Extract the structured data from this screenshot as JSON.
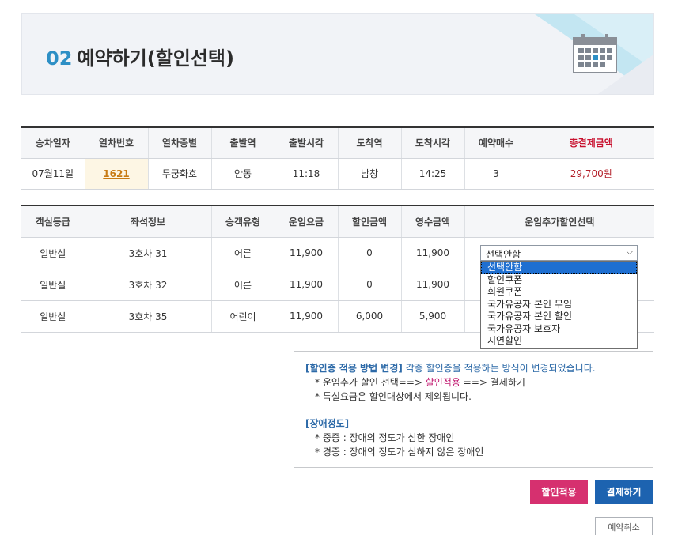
{
  "header": {
    "step_number": "02",
    "title": "예약하기(할인선택)",
    "icon": "calendar-icon"
  },
  "trip_table": {
    "headers": [
      "승차일자",
      "열차번호",
      "열차종별",
      "출발역",
      "출발시각",
      "도착역",
      "도착시각",
      "예약매수",
      "총결제금액"
    ],
    "row": {
      "date": "07월11일",
      "train_no": "1621",
      "train_type": "무궁화호",
      "dep_station": "안동",
      "dep_time": "11:18",
      "arr_station": "남창",
      "arr_time": "14:25",
      "count": "3",
      "total": "29,700원"
    }
  },
  "seat_table": {
    "headers": [
      "객실등급",
      "좌석정보",
      "승객유형",
      "운임요금",
      "할인금액",
      "영수금액",
      "운임추가할인선택"
    ],
    "rows": [
      {
        "grade": "일반실",
        "seat": "3호차 31",
        "type": "어른",
        "fare": "11,900",
        "discount": "0",
        "receipt": "11,900"
      },
      {
        "grade": "일반실",
        "seat": "3호차 32",
        "type": "어른",
        "fare": "11,900",
        "discount": "0",
        "receipt": "11,900"
      },
      {
        "grade": "일반실",
        "seat": "3호차 35",
        "type": "어린이",
        "fare": "11,900",
        "discount": "6,000",
        "receipt": "5,900"
      }
    ]
  },
  "discount_select": {
    "selected": "선택안함",
    "options": [
      "선택안함",
      "할인쿠폰",
      "회원쿠폰",
      "국가유공자 본인 무임",
      "국가유공자 본인 할인",
      "국가유공자 보호자",
      "지연할인"
    ]
  },
  "notice": {
    "change_title": "[할인증 적용 방법 변경]",
    "change_desc": "각종 할인증을 적용하는 방식이 변경되었습니다.",
    "line1_pre": "* 운임추가 할인 선택==>",
    "line1_mid": "할인적용",
    "line1_post": "==> 결제하기",
    "line2": "* 특실요금은 할인대상에서 제외됩니다.",
    "disability_title": "[장애정도]",
    "severe": "* 중증 : 장애의 정도가 심한 장애인",
    "mild": "* 경증 : 장애의 정도가 심하지 않은 장애인"
  },
  "buttons": {
    "apply_discount": "할인적용",
    "pay": "결제하기",
    "cancel": "예약취소"
  },
  "colors": {
    "accent_blue": "#2d8fc5",
    "total_red": "#c8102e",
    "discount_button": "#d6306f",
    "pay_button": "#1d63b0"
  }
}
